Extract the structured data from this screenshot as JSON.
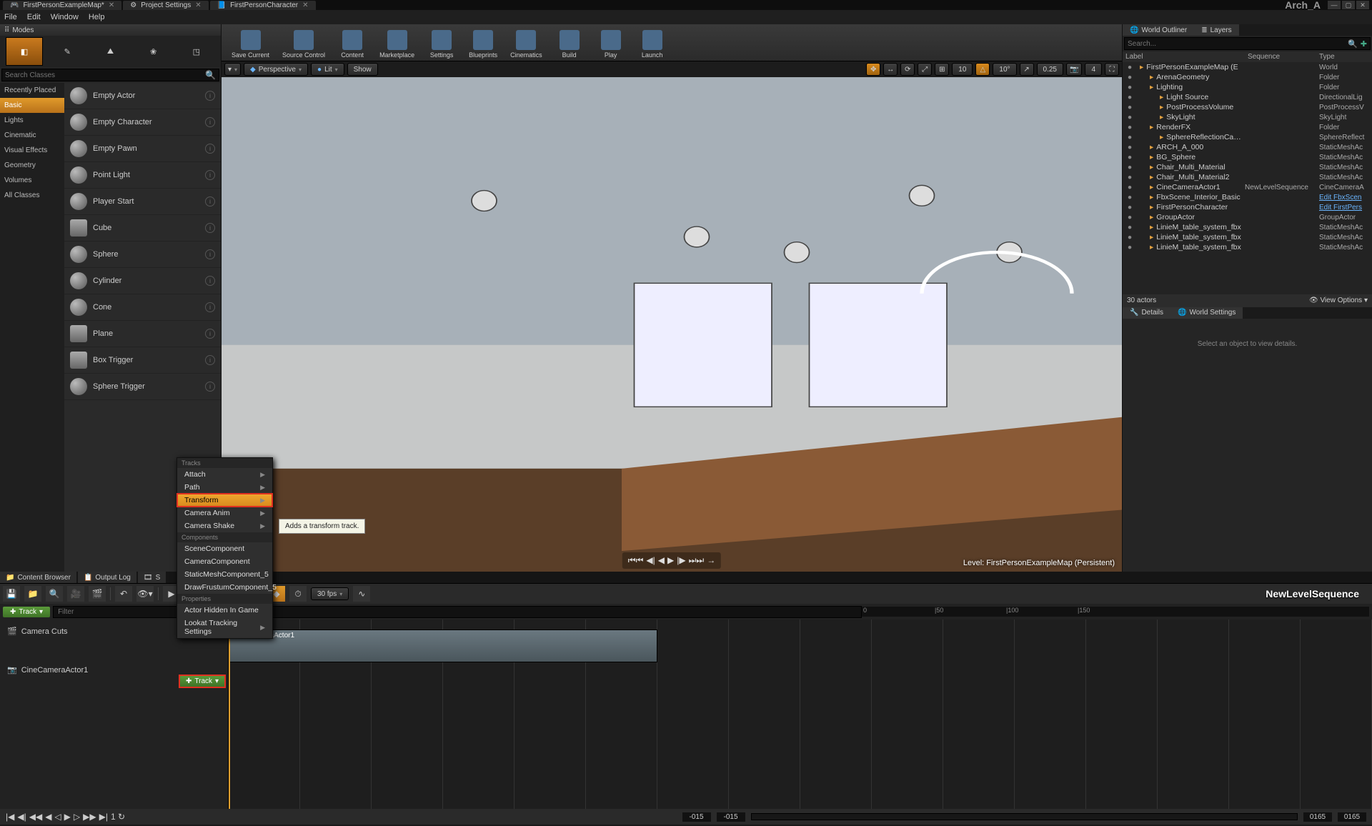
{
  "titlebar": {
    "tabs": [
      "FirstPersonExampleMap*",
      "Project Settings",
      "FirstPersonCharacter"
    ],
    "user": "Arch_A"
  },
  "menubar": [
    "File",
    "Edit",
    "Window",
    "Help"
  ],
  "modes": {
    "title": "Modes",
    "search_placeholder": "Search Classes",
    "categories": [
      "Recently Placed",
      "Basic",
      "Lights",
      "Cinematic",
      "Visual Effects",
      "Geometry",
      "Volumes",
      "All Classes"
    ],
    "active_category": "Basic",
    "assets": [
      "Empty Actor",
      "Empty Character",
      "Empty Pawn",
      "Point Light",
      "Player Start",
      "Cube",
      "Sphere",
      "Cylinder",
      "Cone",
      "Plane",
      "Box Trigger",
      "Sphere Trigger"
    ]
  },
  "toolbar": [
    "Save Current",
    "Source Control",
    "Content",
    "Marketplace",
    "Settings",
    "Blueprints",
    "Cinematics",
    "Build",
    "Play",
    "Launch"
  ],
  "viewport_tools": {
    "left": [
      "Perspective",
      "Lit",
      "Show"
    ],
    "right_snap": "10",
    "right_angle": "10°",
    "right_scale": "0.25",
    "right_cam": "4"
  },
  "viewport": {
    "level_label": "Level:  FirstPersonExampleMap (Persistent)"
  },
  "outliner": {
    "tab1": "World Outliner",
    "tab2": "Layers",
    "search_placeholder": "Search...",
    "cols": {
      "label": "Label",
      "seq": "Sequence",
      "type": "Type"
    },
    "rows": [
      {
        "indent": 0,
        "name": "FirstPersonExampleMap (E",
        "type": "World",
        "eye": "●"
      },
      {
        "indent": 1,
        "name": "ArenaGeometry",
        "type": "Folder",
        "eye": "●"
      },
      {
        "indent": 1,
        "name": "Lighting",
        "type": "Folder",
        "eye": "●"
      },
      {
        "indent": 2,
        "name": "Light Source",
        "type": "DirectionalLig",
        "eye": "●"
      },
      {
        "indent": 2,
        "name": "PostProcessVolume",
        "type": "PostProcessV",
        "eye": "●"
      },
      {
        "indent": 2,
        "name": "SkyLight",
        "type": "SkyLight",
        "eye": "●"
      },
      {
        "indent": 1,
        "name": "RenderFX",
        "type": "Folder",
        "eye": "●"
      },
      {
        "indent": 2,
        "name": "SphereReflectionCaptu",
        "type": "SphereReflect",
        "eye": "●"
      },
      {
        "indent": 1,
        "name": "ARCH_A_000",
        "type": "StaticMeshAc",
        "eye": "●"
      },
      {
        "indent": 1,
        "name": "BG_Sphere",
        "type": "StaticMeshAc",
        "eye": "●"
      },
      {
        "indent": 1,
        "name": "Chair_Multi_Material",
        "type": "StaticMeshAc",
        "eye": "●"
      },
      {
        "indent": 1,
        "name": "Chair_Multi_Material2",
        "type": "StaticMeshAc",
        "eye": "●"
      },
      {
        "indent": 1,
        "name": "CineCameraActor1",
        "seq": "NewLevelSequence",
        "type": "CineCameraA",
        "eye": "●"
      },
      {
        "indent": 1,
        "name": "FbxScene_Interior_Basic",
        "type": "Edit FbxScen",
        "link": true,
        "eye": "●"
      },
      {
        "indent": 1,
        "name": "FirstPersonCharacter",
        "type": "Edit FirstPers",
        "link": true,
        "eye": "●"
      },
      {
        "indent": 1,
        "name": "GroupActor",
        "type": "GroupActor",
        "eye": "●"
      },
      {
        "indent": 1,
        "name": "LinieM_table_system_fbx",
        "type": "StaticMeshAc",
        "eye": "●"
      },
      {
        "indent": 1,
        "name": "LinieM_table_system_fbx",
        "type": "StaticMeshAc",
        "eye": "●"
      },
      {
        "indent": 1,
        "name": "LinieM_table_system_fbx",
        "type": "StaticMeshAc",
        "eye": "●"
      }
    ],
    "footer_count": "30 actors",
    "footer_view": "View Options"
  },
  "details": {
    "tab1": "Details",
    "tab2": "World Settings",
    "empty": "Select an object to view details."
  },
  "seq_tabs": [
    "Content Browser",
    "Output Log",
    "S"
  ],
  "sequencer": {
    "fps": "30 fps",
    "title": "NewLevelSequence",
    "track_btn": "Track",
    "filter_placeholder": "Filter",
    "tracks": [
      "Camera Cuts",
      "CineCameraActor1"
    ],
    "clip_label": "CineCameraActor1",
    "ruler": [
      "0",
      "|50",
      "|100",
      "|150"
    ],
    "foot_nums": [
      "-015",
      "-015",
      "0165",
      "0165"
    ],
    "loop": "1"
  },
  "context_menu": {
    "sections": [
      {
        "title": "Tracks",
        "items": [
          {
            "label": "Attach",
            "sub": true
          },
          {
            "label": "Path",
            "sub": true
          },
          {
            "label": "Transform",
            "sub": true,
            "hi": true
          },
          {
            "label": "Camera Anim",
            "sub": true
          },
          {
            "label": "Camera Shake",
            "sub": true
          }
        ]
      },
      {
        "title": "Components",
        "items": [
          {
            "label": "SceneComponent"
          },
          {
            "label": "CameraComponent"
          },
          {
            "label": "StaticMeshComponent_5"
          },
          {
            "label": "DrawFrustumComponent_5"
          }
        ]
      },
      {
        "title": "Properties",
        "items": [
          {
            "label": "Actor Hidden In Game"
          },
          {
            "label": "Lookat Tracking Settings",
            "sub": true
          }
        ]
      }
    ]
  },
  "tooltip": "Adds a transform track.",
  "track_btn2": "Track"
}
